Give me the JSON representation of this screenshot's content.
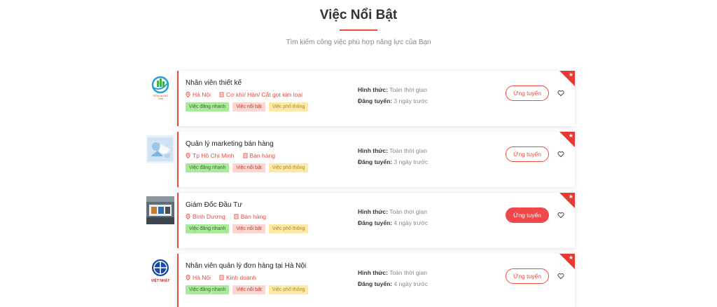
{
  "section": {
    "title": "Việc Nổi Bật",
    "subtitle": "Tìm kiếm công việc phù hợp năng lực của Bạn"
  },
  "labels": {
    "form": "Hình thức:",
    "posted": "Đăng tuyển:",
    "apply": "Ứng tuyển"
  },
  "jobs": [
    {
      "title": "Nhân viên thiết kế",
      "location": "Hà Nội",
      "category": "Cơ khí/ Hàn/ Cắt gọt kim loại",
      "form": "Toàn thời gian",
      "posted": "3 ngày trước",
      "tags": [
        "Việc đăng nhanh",
        "Việc nổi bật",
        "Việc phổ thông"
      ],
      "logo": "tien-hung-logo",
      "apply_active": false
    },
    {
      "title": "Quản lý marketing bán hàng",
      "location": "Tp Hồ Chí Minh",
      "category": "Bán hàng",
      "form": "Toàn thời gian",
      "posted": "3 ngày trước",
      "tags": [
        "Việc đăng nhanh",
        "Việc nổi bật",
        "Việc phổ thông"
      ],
      "logo": "marketing-photo-logo",
      "apply_active": false
    },
    {
      "title": "Giám Đốc Đầu Tư",
      "location": "Bình Dương",
      "category": "Bán hàng",
      "form": "Toàn thời gian",
      "posted": "4 ngày trước",
      "tags": [
        "Việc đăng nhanh",
        "Việc nổi bật",
        "Việc phổ thông"
      ],
      "logo": "building-sign-logo",
      "apply_active": true
    },
    {
      "title": "Nhân viên quản lý đơn hàng tại Hà Nội",
      "location": "Hà Nội",
      "category": "Kinh doanh",
      "form": "Toàn thời gian",
      "posted": "4 ngày trước",
      "tags": [
        "Việc đăng nhanh",
        "Việc nổi bật",
        "Việc phổ thông"
      ],
      "logo": "viet-nhat-logo",
      "apply_active": false
    }
  ],
  "logo_text": {
    "tien_hung": "TIẾN HƯNG",
    "viet_nhat": "VIỆT NHẬT"
  },
  "colors": {
    "accent": "#e74c3c",
    "tag_green": "#a9ea9a",
    "tag_pink": "#fbd6d2",
    "tag_yellow": "#fde9a8"
  }
}
